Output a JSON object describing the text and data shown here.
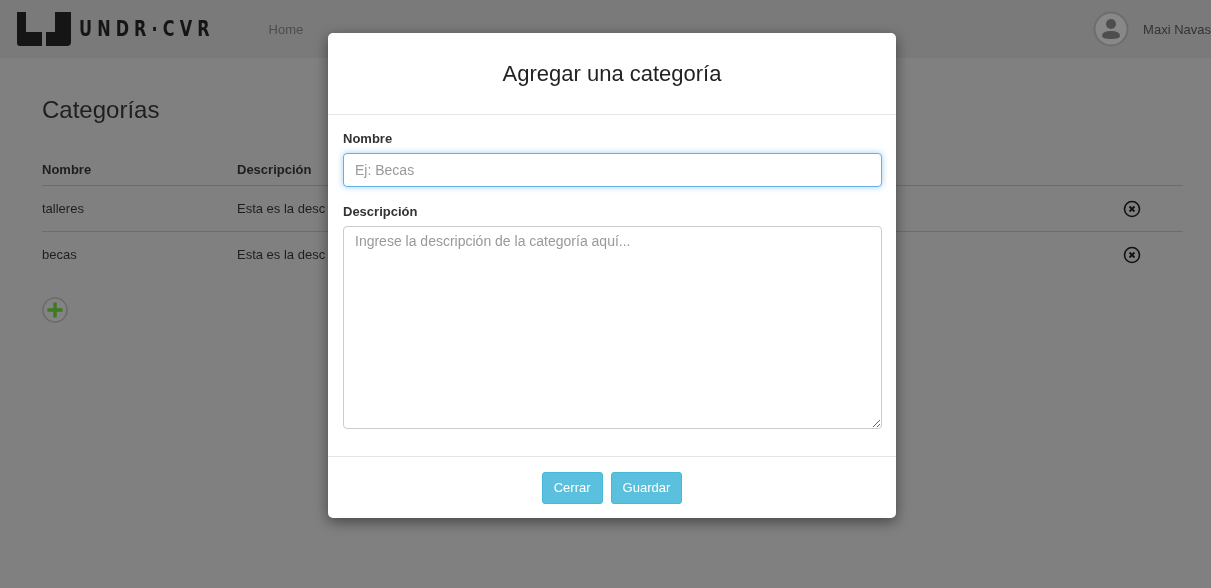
{
  "navbar": {
    "brand": "UNDR·CVR",
    "links": [
      {
        "label": "Home"
      }
    ],
    "user": {
      "name": "Maxi Navas"
    }
  },
  "page": {
    "title": "Categorías",
    "table": {
      "columns": [
        "Nombre",
        "Descripción"
      ],
      "rows": [
        {
          "cells": [
            "talleres",
            "Esta es la desc"
          ]
        },
        {
          "cells": [
            "becas",
            "Esta es la desc"
          ]
        }
      ]
    }
  },
  "modal": {
    "title": "Agregar una categoría",
    "fields": [
      {
        "kind": "input",
        "label": "Nombre",
        "placeholder": "Ej: Becas",
        "focused": true
      },
      {
        "kind": "textarea",
        "label": "Descripción",
        "placeholder": "Ingrese la descripción de la categoría aquí...",
        "focused": false
      }
    ],
    "buttons": [
      "Cerrar",
      "Guardar"
    ]
  }
}
